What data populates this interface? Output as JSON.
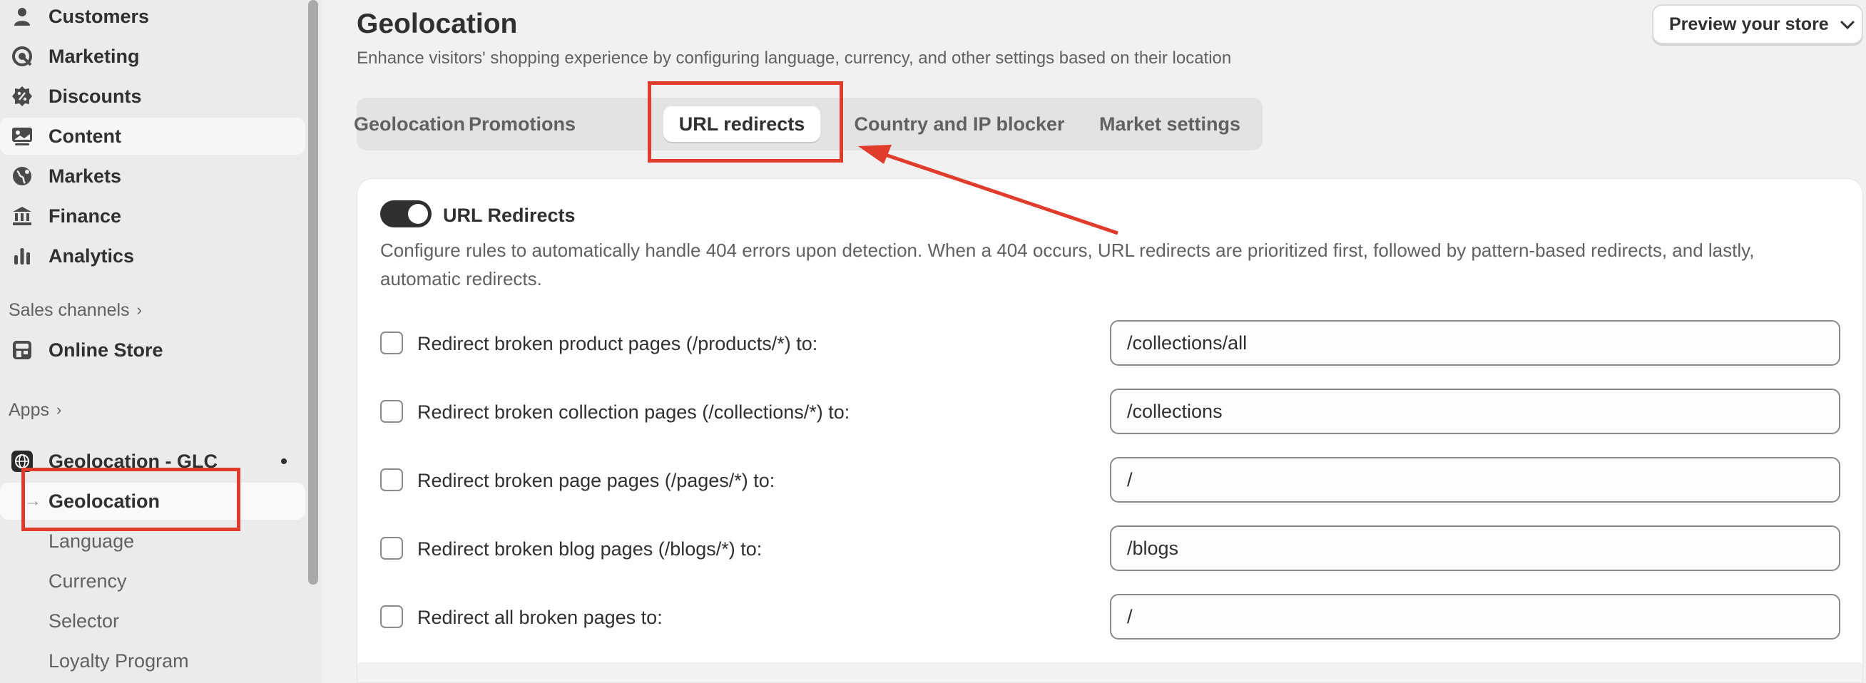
{
  "sidebar": {
    "items": [
      {
        "label": "Customers",
        "icon": "person-icon"
      },
      {
        "label": "Marketing",
        "icon": "target-icon"
      },
      {
        "label": "Discounts",
        "icon": "discount-badge-icon"
      },
      {
        "label": "Content",
        "icon": "image-icon"
      },
      {
        "label": "Markets",
        "icon": "globe-icon"
      },
      {
        "label": "Finance",
        "icon": "bank-icon"
      },
      {
        "label": "Analytics",
        "icon": "bar-chart-icon"
      }
    ],
    "sales_channels": {
      "label": "Sales channels",
      "chevron": "›"
    },
    "online_store": {
      "label": "Online Store",
      "icon": "store-icon"
    },
    "apps": {
      "label": "Apps",
      "chevron": "›"
    },
    "app": {
      "label": "Geolocation - GLC",
      "icon": "app-globe-icon"
    },
    "app_subitems": [
      {
        "label": "Geolocation"
      },
      {
        "label": "Language"
      },
      {
        "label": "Currency"
      },
      {
        "label": "Selector"
      },
      {
        "label": "Loyalty Program"
      }
    ],
    "active_arrow": "→"
  },
  "header": {
    "title": "Geolocation",
    "subtitle": "Enhance visitors' shopping experience by configuring language, currency, and other settings based on their location",
    "preview_button": "Preview your store",
    "preview_chevron": "⌄"
  },
  "tabs": [
    {
      "label": "Geolocation"
    },
    {
      "label": "Promotions"
    },
    {
      "label": "URL redirects"
    },
    {
      "label": "Country and IP blocker"
    },
    {
      "label": "Market settings"
    }
  ],
  "card": {
    "toggle_label": "URL Redirects",
    "toggle_on": true,
    "description": "Configure rules to automatically handle 404 errors upon detection. When a 404 occurs, URL redirects are prioritized first, followed by pattern-based redirects, and lastly, automatic redirects.",
    "rows": [
      {
        "label": "Redirect broken product pages (/products/*) to:",
        "value": "/collections/all"
      },
      {
        "label": "Redirect broken collection pages (/collections/*) to:",
        "value": "/collections"
      },
      {
        "label": "Redirect broken page pages (/pages/*) to:",
        "value": "/"
      },
      {
        "label": "Redirect broken blog pages (/blogs/*) to:",
        "value": "/blogs"
      },
      {
        "label": "Redirect all broken pages to:",
        "value": "/"
      }
    ]
  },
  "colors": {
    "annotation": "#e03c2c",
    "toggle": "#303030"
  }
}
